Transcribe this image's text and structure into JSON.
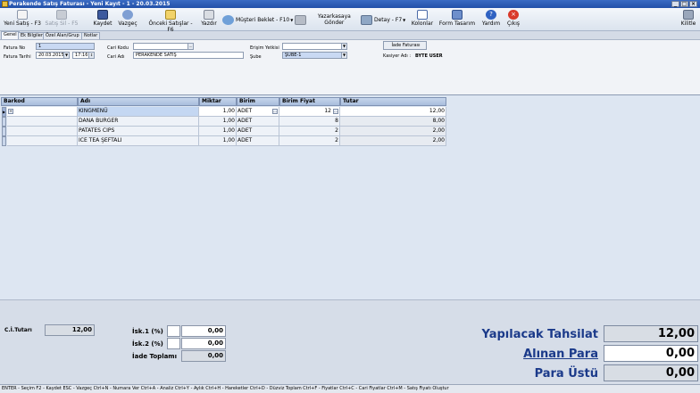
{
  "window": {
    "title": "Perakende Satış Faturası - Yeni Kayıt - 1 - 20.03.2015"
  },
  "toolbar": {
    "new_sale": "Yeni Satış - F3",
    "delete_sale": "Satış Sil - F5",
    "save": "Kaydet",
    "cancel": "Vazgeç",
    "prev_sales": "Önceki Satışlar - F6",
    "print": "Yazdır",
    "hold_customer": "Müşteri Beklet - F10",
    "send_register": "Yazarkasaya Gönder",
    "details": "Detay - F7",
    "columns": "Kolonlar",
    "form_design": "Form Tasarım",
    "help": "Yardım",
    "exit": "Çıkış",
    "lock": "Kilitle"
  },
  "tabs": [
    "Genel",
    "Ek Bilgiler",
    "Özel Alan/Grup",
    "Notlar"
  ],
  "form": {
    "invoice_no_label": "Fatura No",
    "invoice_no": "1",
    "invoice_date_label": "Fatura Tarihi",
    "invoice_date": "20.03.2015",
    "invoice_time": "17:16",
    "account_code_label": "Cari Kodu",
    "account_code": "",
    "account_name_label": "Cari Adı",
    "account_name": "PERAKENDE SATIŞ",
    "authority_label": "Erişim Yetkisi",
    "authority": "",
    "branch_label": "Şube",
    "branch": "ŞUBE-1",
    "return_invoice_button": "İade Faturası",
    "cashier_label": "Kasiyer Adı :",
    "cashier": "BYTE USER"
  },
  "grid": {
    "headers": [
      "Barkod",
      "Adı",
      "Miktar",
      "Birim",
      "Birim Fiyat",
      "Tutar"
    ],
    "rows": [
      {
        "barcode": "",
        "name": "KINGMENÜ",
        "qty": "1,00",
        "unit": "ADET",
        "price": "12",
        "total": "12,00"
      },
      {
        "barcode": "",
        "name": "DANA BURGER",
        "qty": "1,00",
        "unit": "ADET",
        "price": "8",
        "total": "8,00"
      },
      {
        "barcode": "",
        "name": "PATATES CIPS",
        "qty": "1,00",
        "unit": "ADET",
        "price": "2",
        "total": "2,00"
      },
      {
        "barcode": "",
        "name": "ICE TEA ŞEFTALI",
        "qty": "1,00",
        "unit": "ADET",
        "price": "2",
        "total": "2,00"
      }
    ]
  },
  "summary": {
    "ci_total_label": "C.İ.Tutarı",
    "ci_total": "12,00",
    "discount1_label": "İsk.1 (%)",
    "discount1": "0,00",
    "discount2_label": "İsk.2 (%)",
    "discount2": "0,00",
    "return_total_label": "İade Toplamı",
    "return_total": "0,00",
    "payable_label": "Yapılacak Tahsilat",
    "payable": "12,00",
    "received_label": "Alınan Para",
    "received": "0,00",
    "change_label": "Para Üstü",
    "change": "0,00"
  },
  "status": {
    "text": "ENTER - Seçim  F2 - Kaydet  ESC - Vazgeç  Ctrl+N - Numara Ver   Ctrl+A - Analiz  Ctrl+Y - Aylık  Ctrl+H - Hareketler  Ctrl+D - Düzviz Toplam  Ctrl+F - Fiyatlar  Ctrl+C - Cari Fiyatlar  Ctrl+M - Satış Fiyatı Oluştur"
  },
  "colors": {
    "titlebar": "#2a5ab8",
    "accent_text": "#1b3a8a",
    "selected_field": "#c9d9f3",
    "grid_header": "#b7c9e5",
    "exit_icon": "#d93a2b"
  }
}
